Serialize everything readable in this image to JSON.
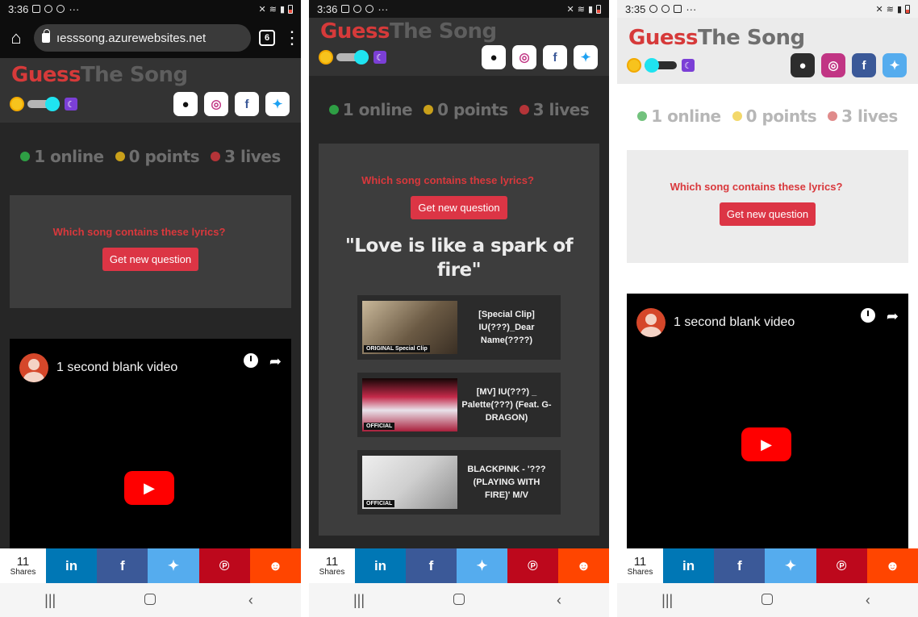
{
  "screens": [
    {
      "status": {
        "time": "3:36",
        "dots": "···"
      },
      "url": {
        "text": "ıesssong.azurewebsites.net",
        "tab_count": "6"
      },
      "brand": {
        "part1": "Guess",
        "part2": "The Song"
      },
      "stats": {
        "online": "1 online",
        "points": "0 points",
        "lives": "3 lives"
      },
      "question": "Which song contains these lyrics?",
      "button": "Get new question",
      "video": {
        "title": "1 second blank video"
      },
      "share": {
        "count": "11",
        "label": "Shares"
      }
    },
    {
      "status": {
        "time": "3:36",
        "dots": "···"
      },
      "brand": {
        "part1": "Guess",
        "part2": "The Song"
      },
      "stats": {
        "online": "1 online",
        "points": "0 points",
        "lives": "3 lives"
      },
      "question": "Which song contains these lyrics?",
      "button": "Get new question",
      "lyric": "\"Love is like a spark of fire\"",
      "options": [
        {
          "title": "[Special Clip] IU(???)_Dear Name(????)",
          "badge": "ORIGINAL  Special Clip"
        },
        {
          "title": "[MV] IU(???) _ Palette(???) (Feat. G-DRAGON)",
          "badge": "OFFICIAL"
        },
        {
          "title": "BLACKPINK - '??? (PLAYING WITH FIRE)' M/V",
          "badge": "OFFICIAL"
        }
      ],
      "share": {
        "count": "11",
        "label": "Shares"
      }
    },
    {
      "status": {
        "time": "3:35",
        "dots": "···"
      },
      "brand": {
        "part1": "Guess",
        "part2": "The Song"
      },
      "stats": {
        "online": "1 online",
        "points": "0 points",
        "lives": "3 lives"
      },
      "question": "Which song contains these lyrics?",
      "button": "Get new question",
      "video": {
        "title": "1 second blank video"
      },
      "share": {
        "count": "11",
        "label": "Shares"
      }
    }
  ],
  "social_icons": {
    "github": "f",
    "instagram": "◎",
    "facebook": "f",
    "twitter": "🐦"
  },
  "share_icons": {
    "linkedin": "in",
    "facebook": "f",
    "twitter": "🐦",
    "pinterest": "℗",
    "reddit": "☻"
  },
  "nav_icons": {
    "recents": "|||",
    "back": "‹"
  },
  "toggle": {
    "dark_mode_on_screen1": true,
    "dark_mode_on_screen2": true,
    "dark_mode_on_screen3": false
  },
  "colors": {
    "accent_red": "#dc3545",
    "brand_red": "#d63a3a",
    "online": "#2e9e44",
    "points": "#e0b21e",
    "lives": "#c93a3e",
    "light_online": "#72c27d",
    "light_points": "#f3d86a",
    "light_lives": "#e08b8b"
  }
}
